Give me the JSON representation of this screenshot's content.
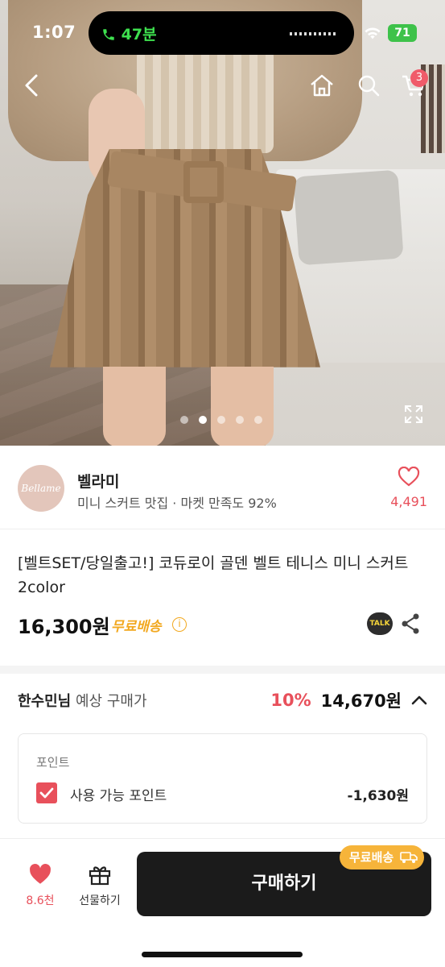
{
  "status_bar": {
    "time": "1:07",
    "call": "47분",
    "battery": "71"
  },
  "nav": {
    "back_icon": "chevron-left-icon",
    "home_icon": "home-icon",
    "search_icon": "search-icon",
    "cart_icon": "cart-icon",
    "cart_badge": "3"
  },
  "gallery": {
    "total": 5,
    "active_index": 1,
    "expand_icon": "expand-icon"
  },
  "seller": {
    "logo_text": "Bellame",
    "name": "벨라미",
    "subtitle": "미니 스커트 맛집 · 마켓 만족도 92%",
    "like_count": "4,491"
  },
  "product": {
    "title": "[벨트SET/당일출고!] 코듀로이 골덴 벨트 테니스 미니 스커트 2color",
    "price": "16,300원",
    "free_shipping": "무료배송",
    "talk_label": "TALK"
  },
  "member_price": {
    "name": "한수민님",
    "label": "예상 구매가",
    "discount": "10%",
    "price": "14,670원"
  },
  "points": {
    "title": "포인트",
    "label": "사용 가능 포인트",
    "checked": true,
    "value": "-1,630원"
  },
  "bottom_bar": {
    "like_count": "8.6천",
    "gift_label": "선물하기",
    "buy_label": "구매하기",
    "shipping_tag": "무료배송"
  },
  "colors": {
    "accent_red": "#e8505b",
    "shipping_orange": "#f2a81f",
    "buy_button": "#1b1b1b"
  }
}
